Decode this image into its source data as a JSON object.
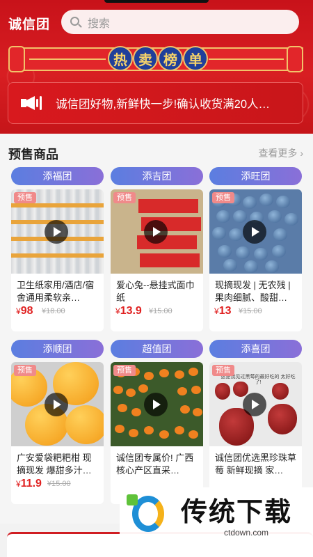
{
  "header": {
    "brand": "诚信团",
    "search_placeholder": "搜索",
    "banner_chars": [
      "热",
      "卖",
      "榜",
      "单"
    ]
  },
  "notice": {
    "text": "诚信团好物,新鲜快一步!确认收货满20人…"
  },
  "presale": {
    "title": "预售商品",
    "more": "查看更多",
    "tag": "预售",
    "products": [
      {
        "group": "添福团",
        "name": "卫生纸家用/酒店/宿舍通用柔软亲…",
        "price": "98",
        "old_price": "¥18.00"
      },
      {
        "group": "添吉团",
        "name": "爱心兔--悬挂式面巾纸",
        "price": "13.9",
        "old_price": "¥15.00"
      },
      {
        "group": "添旺团",
        "name": "现摘现发 | 无农残 | 果肉细腻、酸甜…",
        "price": "13",
        "old_price": "¥15.00"
      },
      {
        "group": "添顺团",
        "name": "广安爱袋粑粑柑 现摘现发 爆甜多汁…",
        "price": "11.9",
        "old_price": "¥15.00"
      },
      {
        "group": "超值团",
        "name": "诚信团专属价! 广西核心产区直采…",
        "price": "",
        "old_price": ""
      },
      {
        "group": "添喜团",
        "name": "诚信团优选黑珍珠草莓 新鲜现摘 家…",
        "price": "",
        "old_price": ""
      }
    ],
    "strawberry_caption": "这是我见过黑莓的最好吃的 太好吃了!"
  },
  "watermark": {
    "title": "传统下载",
    "url": "ctdown.com"
  },
  "colors": {
    "primary_red": "#d81e22",
    "price_red": "#e02020",
    "pill_gradient_start": "#5b7ee0",
    "pill_gradient_end": "#8a6fd8"
  },
  "icons": {
    "search": "search-icon",
    "notice": "speaker-icon",
    "more": "chevron-right-icon",
    "video": "play-icon"
  }
}
